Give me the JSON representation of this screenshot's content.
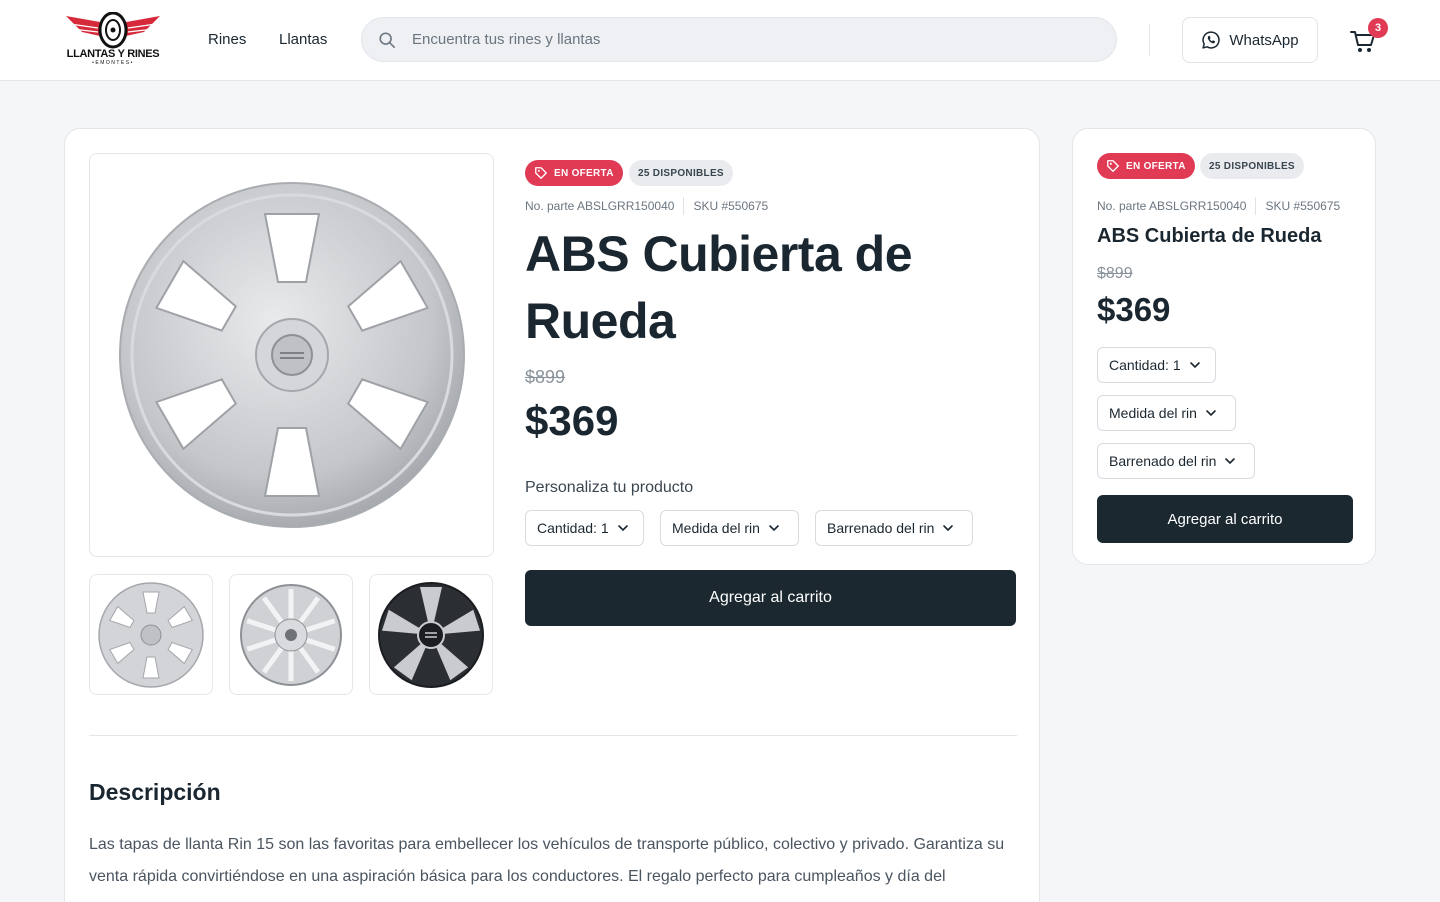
{
  "header": {
    "logo_text": "LLANTAS Y RINES",
    "logo_sub": "•EMONTES•",
    "nav": [
      {
        "label": "Rines"
      },
      {
        "label": "Llantas"
      }
    ],
    "search_placeholder": "Encuentra tus rines y llantas",
    "whatsapp_label": "WhatsApp",
    "cart_count": "3",
    "colors": {
      "brand_red": "#e03a55",
      "dark": "#1b2830"
    }
  },
  "product": {
    "badge_offer": "EN OFERTA",
    "badge_stock": "25 DISPONIBLES",
    "part_number": "No. parte ABSLGRR150040",
    "sku": "SKU #550675",
    "title": "ABS Cubierta de Rueda",
    "old_price": "$899",
    "price": "$369",
    "customize_label": "Personaliza tu producto",
    "quantity_label": "Cantidad: 1",
    "size_label": "Medida del rin",
    "bolt_label": "Barrenado del rin",
    "add_to_cart": "Agregar al carrito",
    "images": [
      {
        "icon": "hubcap-six-spoke-image"
      },
      {
        "icon": "hubcap-multi-spoke-image"
      },
      {
        "icon": "hubcap-black-silver-image"
      }
    ]
  },
  "description": {
    "title": "Descripción",
    "text": "Las tapas de llanta Rin 15 son las favoritas para embellecer los vehículos de transporte público, colectivo y privado. Garantiza su venta rápida convirtiéndose en una aspiración básica para los conductores. El regalo perfecto para cumpleaños y día del"
  },
  "sidebar": {
    "badge_offer": "EN OFERTA",
    "badge_stock": "25 DISPONIBLES",
    "part_number": "No. parte ABSLGRR150040",
    "sku": "SKU #550675",
    "title": "ABS Cubierta de Rueda",
    "old_price": "$899",
    "price": "$369",
    "quantity_label": "Cantidad: 1",
    "size_label": "Medida del rin",
    "bolt_label": "Barrenado del rin",
    "add_to_cart": "Agregar al carrito"
  }
}
